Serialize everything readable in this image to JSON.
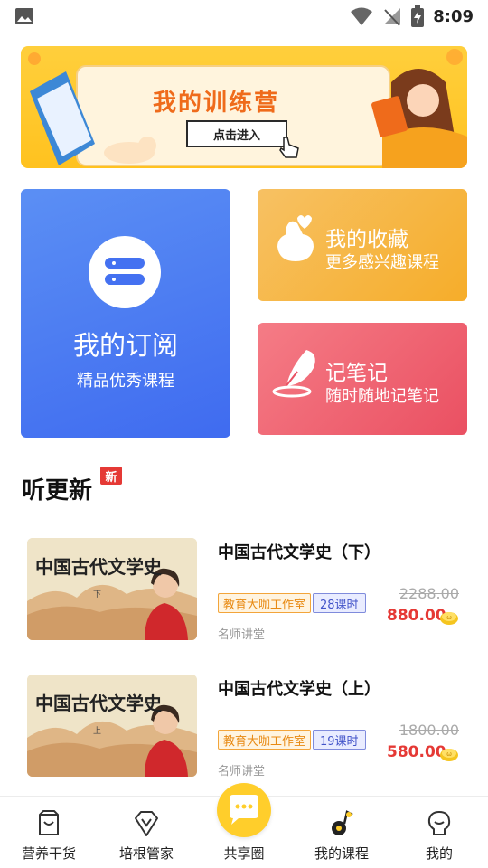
{
  "status_bar": {
    "time": "8:09"
  },
  "banner": {
    "title": "我的训练营",
    "button_label": "点击进入"
  },
  "cards": {
    "subscribe": {
      "title": "我的订阅",
      "desc": "精品优秀课程"
    },
    "favorite": {
      "title": "我的收藏",
      "desc": "更多感兴趣课程"
    },
    "notes": {
      "title": "记笔记",
      "desc": "随时随地记笔记"
    }
  },
  "section": {
    "title": "听更新",
    "badge": "新"
  },
  "courses": [
    {
      "thumb_title": "中国古代文学史",
      "thumb_volume": "下",
      "title": "中国古代文学史（下）",
      "studio_tag": "教育大咖工作室",
      "lessons_tag": "28课时",
      "source": "名师讲堂",
      "price_old": "2288.00",
      "price_new": "880.00"
    },
    {
      "thumb_title": "中国古代文学史",
      "thumb_volume": "上",
      "title": "中国古代文学史（上）",
      "studio_tag": "教育大咖工作室",
      "lessons_tag": "19课时",
      "source": "名师讲堂",
      "price_old": "1800.00",
      "price_new": "580.00"
    }
  ],
  "bottom_nav": [
    {
      "label": "营养干货",
      "icon": "bag-icon"
    },
    {
      "label": "培根管家",
      "icon": "diamond-v-icon"
    },
    {
      "label": "共享圈",
      "icon": "chat-bubble-icon"
    },
    {
      "label": "我的课程",
      "icon": "music-note-icon"
    },
    {
      "label": "我的",
      "icon": "person-icon"
    }
  ],
  "colors": {
    "banner": "#ffc21f",
    "subscribe": "#4673f1",
    "favorite": "#f6b43a",
    "notes": "#ee5b6b",
    "price": "#e53935",
    "accent": "#ffce2b"
  }
}
